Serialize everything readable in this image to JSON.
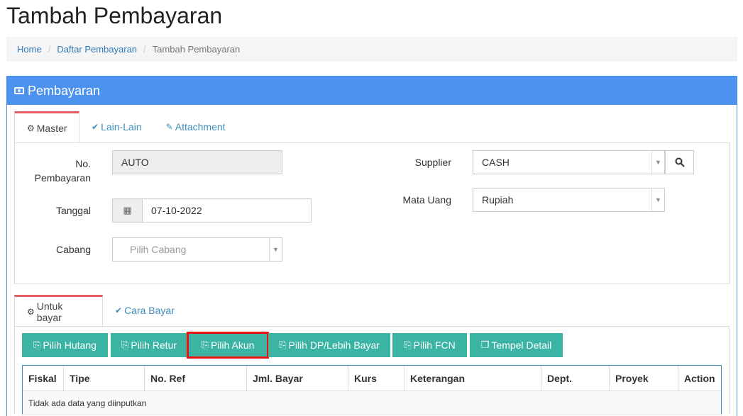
{
  "page": {
    "title": "Tambah Pembayaran"
  },
  "breadcrumb": {
    "home": "Home",
    "list": "Daftar Pembayaran",
    "current": "Tambah Pembayaran",
    "separator": "/"
  },
  "panel": {
    "title": "Pembayaran",
    "icon": "money-icon"
  },
  "master_tabs": [
    {
      "label": "Master",
      "icon": "cogs-icon",
      "active": true
    },
    {
      "label": "Lain-Lain",
      "icon": "check-circle-icon",
      "active": false
    },
    {
      "label": "Attachment",
      "icon": "paperclip-icon",
      "active": false
    }
  ],
  "form": {
    "no_label": "No. Pembayaran",
    "no_label_line1": "No.",
    "no_label_line2": "Pembayaran",
    "no_value": "AUTO",
    "tanggal_label": "Tanggal",
    "tanggal_value": "07-10-2022",
    "cabang_label": "Cabang",
    "cabang_placeholder": "Pilih Cabang",
    "supplier_label": "Supplier",
    "supplier_value": "CASH",
    "mata_uang_label": "Mata Uang",
    "mata_uang_value": "Rupiah"
  },
  "detail_tabs": [
    {
      "label": "Untuk bayar",
      "icon": "cogs-icon",
      "active": true
    },
    {
      "label": "Cara Bayar",
      "icon": "check-circle-icon",
      "active": false
    }
  ],
  "actions": {
    "pilih_hutang": "Pilih Hutang",
    "pilih_retur": "Pilih Retur",
    "pilih_akun": "Pilih Akun",
    "pilih_dp": "Pilih DP/Lebih Bayar",
    "pilih_fcn": "Pilih FCN",
    "tempel_detail": "Tempel Detail"
  },
  "table": {
    "columns": [
      "Fiskal",
      "Tipe",
      "No. Ref",
      "Jml. Bayar",
      "Kurs",
      "Keterangan",
      "Dept.",
      "Proyek",
      "Action"
    ],
    "empty_text": "Tidak ada data yang diinputkan"
  },
  "colors": {
    "primary": "#4c93f0",
    "teal": "#3cb4a4",
    "tab_active": "#e35d5d",
    "highlight": "#e11111"
  }
}
